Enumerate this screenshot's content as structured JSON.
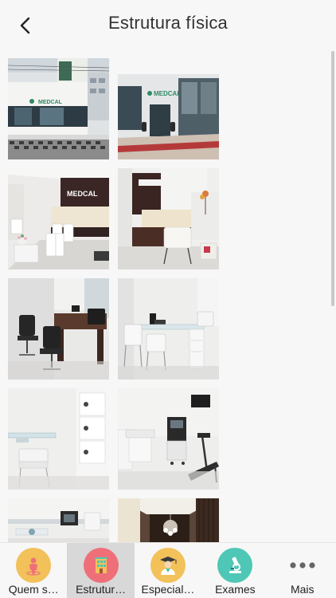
{
  "header": {
    "title": "Estrutura física"
  },
  "photos": [
    {
      "name": "photo-facade-street",
      "text": "MEDCAL"
    },
    {
      "name": "photo-facade-entrance",
      "text": "MEDCAL"
    },
    {
      "name": "photo-reception-wide",
      "text": "MEDCAL"
    },
    {
      "name": "photo-reception-desk"
    },
    {
      "name": "photo-office-dark"
    },
    {
      "name": "photo-office-white"
    },
    {
      "name": "photo-exam-room-gyn"
    },
    {
      "name": "photo-exam-room-treadmill"
    },
    {
      "name": "photo-ultrasound-room"
    },
    {
      "name": "photo-corridor-chandelier"
    }
  ],
  "tabs": [
    {
      "label": "Quem s…",
      "icon": "person-icon",
      "color": "#f2c15a",
      "active": false
    },
    {
      "label": "Estrutur…",
      "icon": "building-icon",
      "color": "#ef6f79",
      "active": true
    },
    {
      "label": "Especial…",
      "icon": "doctor-icon",
      "color": "#f2c15a",
      "active": false
    },
    {
      "label": "Exames",
      "icon": "microscope-icon",
      "color": "#4ec7b6",
      "active": false
    },
    {
      "label": "Mais",
      "icon": "more-dots-icon",
      "color": "none",
      "active": false
    }
  ],
  "colors": {
    "background": "#f7f7f7",
    "active_tab": "#d8d8d8",
    "brand_green": "#2f8a63"
  }
}
